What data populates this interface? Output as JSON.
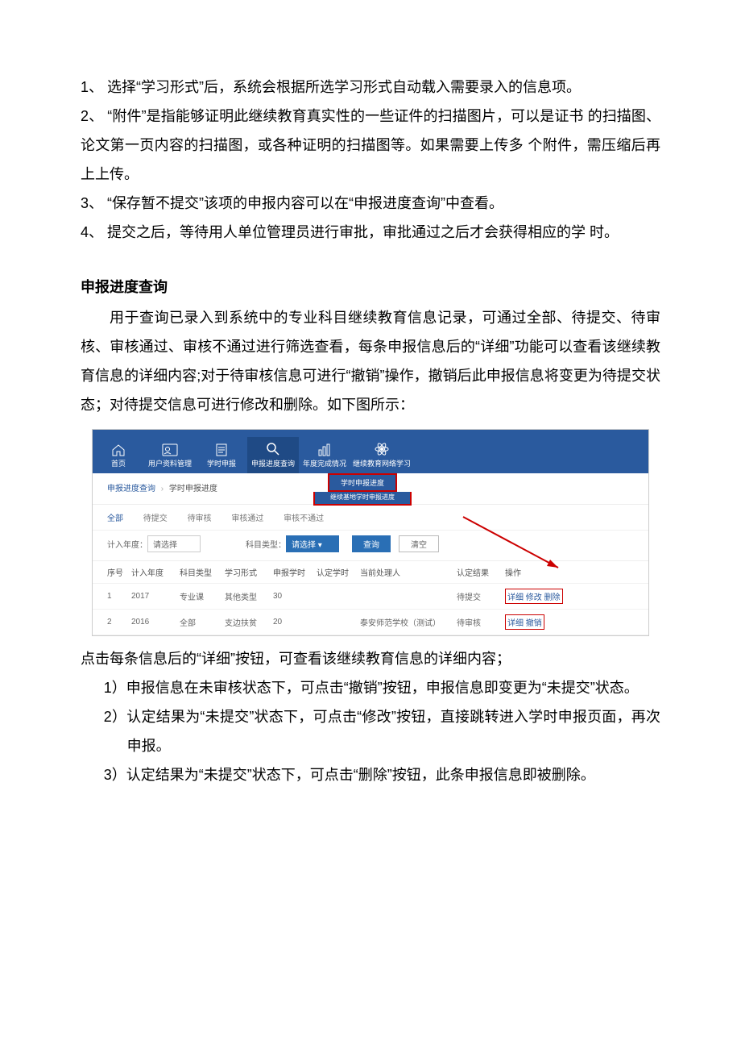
{
  "para1": "1、 选择“学习形式”后，系统会根据所选学习形式自动载入需要录入的信息项。",
  "para2": "2、 “附件”是指能够证明此继续教育真实性的一些证件的扫描图片，可以是证书 的扫描图、论文第一页内容的扫描图，或各种证明的扫描图等。如果需要上传多 个附件，需压缩后再上上传。",
  "para3": "3、 “保存暂不提交”该项的申报内容可以在“申报进度查询”中查看。",
  "para4": "4、 提交之后，等待用人单位管理员进行审批，审批通过之后才会获得相应的学 时。",
  "section_title": "申报进度查询",
  "intro": "用于查询已录入到系统中的专业科目继续教育信息记录，可通过全部、待提交、待审核、审核通过、审核不通过进行筛选查看，每条申报信息后的“详细”功能可以查看该继续教育信息的详细内容;对于待审核信息可进行“撤销”操作，撤销后此申报信息将变更为待提交状态；对待提交信息可进行修改和删除。如下图所示：",
  "fig": {
    "nav": [
      "首页",
      "用户资料管理",
      "学时申报",
      "申报进度查询",
      "年度完成情况",
      "继续教育网络学习"
    ],
    "sub1": "学时申报进度",
    "sub2": "继续基地学时申报进度",
    "crumb1": "申报进度查询",
    "crumb2": "学时申报进度",
    "tabs": [
      "全部",
      "待提交",
      "待审核",
      "审核通过",
      "审核不通过"
    ],
    "filter_year_label": "计入年度：",
    "filter_year_ph": "请选择",
    "filter_type_label": "科目类型：",
    "filter_type_ph": "请选择",
    "btn_query": "查询",
    "btn_clear": "清空",
    "headers": [
      "序号",
      "计入年度",
      "科目类型",
      "学习形式",
      "申报学时",
      "认定学时",
      "当前处理人",
      "认定结果",
      "操作"
    ],
    "rows": [
      {
        "no": "1",
        "year": "2017",
        "type": "专业课",
        "form": "其他类型",
        "sbxs": "30",
        "rdxs": "",
        "handler": "",
        "result": "待提交",
        "ops": "详细 修改 删除"
      },
      {
        "no": "2",
        "year": "2016",
        "type": "全部",
        "form": "支边扶贫",
        "sbxs": "20",
        "rdxs": "",
        "handler": "泰安师范学校（测试）",
        "result": "待审核",
        "ops": "详细 撤销"
      }
    ]
  },
  "after_fig": "点击每条信息后的“详细”按钮，可查看该继续教育信息的详细内容；",
  "li1": "1）申报信息在未审核状态下，可点击“撤销”按钮，申报信息即变更为“未提交”状态。",
  "li2": "2）认定结果为“未提交”状态下，可点击“修改”按钮，直接跳转进入学时申报页面，再次申报。",
  "li3": "3）认定结果为“未提交”状态下，可点击“删除”按钮，此条申报信息即被删除。"
}
